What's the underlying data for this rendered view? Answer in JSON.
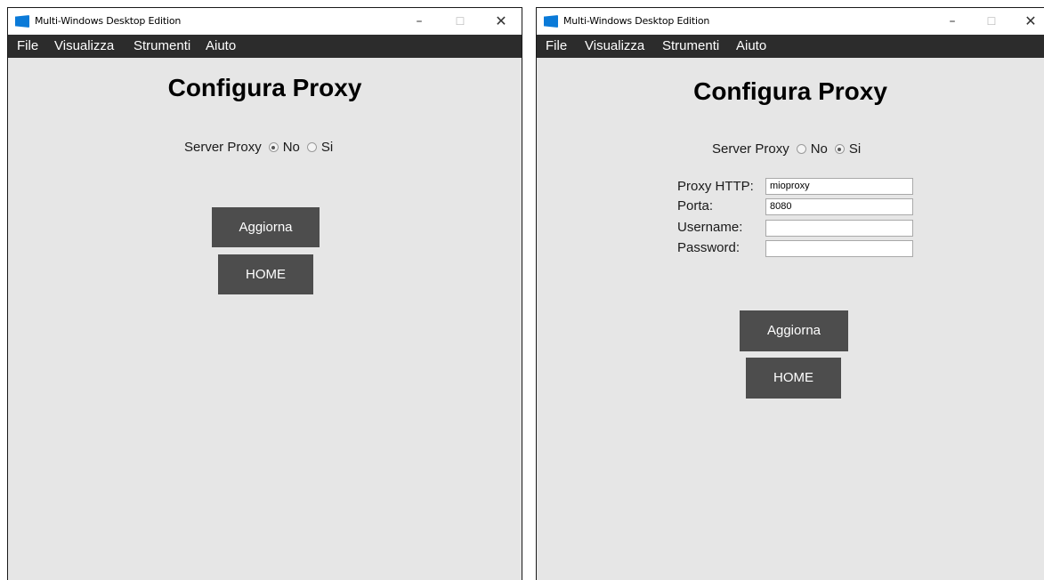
{
  "window_title": "Multi-Windows Desktop Edition",
  "window_controls": {
    "minimize": "–",
    "maximize": "☐",
    "close": "✕"
  },
  "menu": {
    "file": "File",
    "view": "Visualizza",
    "tools": "Strumenti",
    "help": "Aiuto"
  },
  "heading": "Configura Proxy",
  "proxy_label": "Server Proxy",
  "option_no": "No",
  "option_si": "Si",
  "left": {
    "selected": "No"
  },
  "right": {
    "selected": "Si",
    "fields": {
      "http_label": "Proxy HTTP:",
      "http_value": "mioproxy",
      "port_label": "Porta:",
      "port_value": "8080",
      "username_label": "Username:",
      "username_value": "",
      "password_label": "Password:",
      "password_value": ""
    }
  },
  "update_button": "Aggiorna",
  "home_button": "HOME",
  "colors": {
    "menubar": "#2c2c2c",
    "content_bg": "#e6e6e6",
    "button_bg": "#4d4d4d",
    "app_icon": "#0a7ad8"
  }
}
